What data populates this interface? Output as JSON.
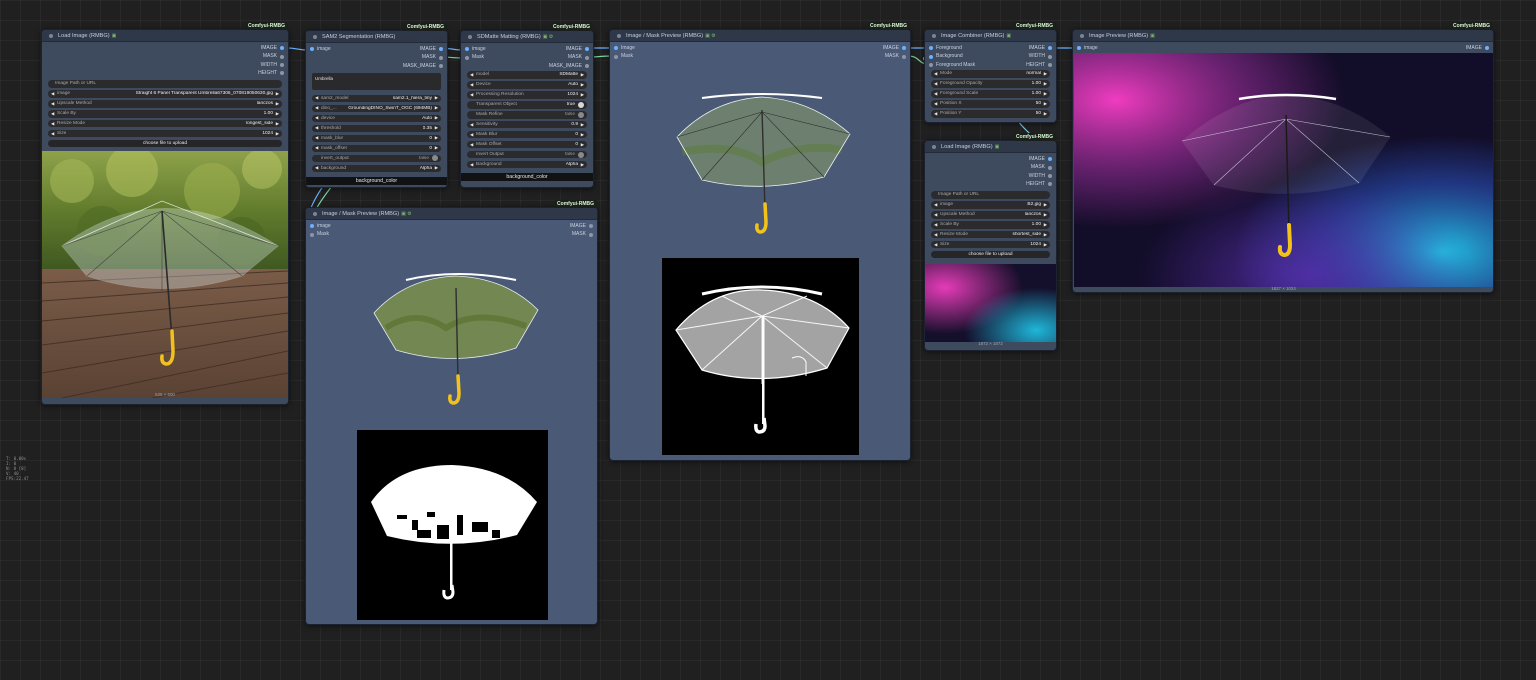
{
  "canvas_stats": [
    "T: 0.00s",
    "I: 0",
    "N: 8 [8]",
    "V: 40",
    "FPS:22.47"
  ],
  "node_load_image": {
    "badge": "Comfyui-RMBG",
    "title": "Load Image (RMBG)",
    "emoji": "🖼",
    "outputs": [
      "IMAGE",
      "MASK",
      "WIDTH",
      "HEIGHT"
    ],
    "path_placeholder": "Image Path or URL",
    "image_label": "image",
    "image_value": "Straight 6 Panel Transparent Umbrella67306_070819050630.jpg",
    "upscale_label": "Upscale Method",
    "upscale_value": "lanczos",
    "scale_label": "Scale By",
    "scale_value": "1.00",
    "resize_label": "Resize Mode",
    "resize_value": "longest_side",
    "size_label": "Size",
    "size_value": "1024",
    "upload_button": "choose file to upload",
    "caption": "625 × 600"
  },
  "node_sam2": {
    "badge": "Comfyui-RMBG",
    "title": "SAM2 Segmentation (RMBG)",
    "inputs": [
      "image"
    ],
    "outputs": [
      "IMAGE",
      "MASK",
      "MASK_IMAGE"
    ],
    "prompt_text": "Umbrella",
    "widgets": [
      {
        "label": "sam2_model",
        "value": "sam2.1_hiera_tiny"
      },
      {
        "label": "dino_...",
        "value": "GroundingDINO_SwinT_OGC (694MB)"
      },
      {
        "label": "device",
        "value": "Auto"
      },
      {
        "label": "threshold",
        "value": "0.35"
      },
      {
        "label": "mask_blur",
        "value": "0"
      },
      {
        "label": "mask_offset",
        "value": "0"
      },
      {
        "label": "invert_output",
        "value": "false"
      },
      {
        "label": "background",
        "value": "Alpha"
      }
    ],
    "bg_color_label": "background_color"
  },
  "node_sdmatte": {
    "badge": "Comfyui-RMBG",
    "title": "SDMatte Matting (RMBG)",
    "inputs": [
      "image",
      "Mask"
    ],
    "outputs": [
      "IMAGE",
      "MASK",
      "MASK_IMAGE"
    ],
    "widgets": [
      {
        "label": "model",
        "value": "SDMatte",
        "kind": "select"
      },
      {
        "label": "Device",
        "value": "Auto",
        "kind": "select"
      },
      {
        "label": "Processing Resolution",
        "value": "1024",
        "kind": "select"
      },
      {
        "label": "Transparent Object",
        "value": "true",
        "kind": "toggle-on"
      },
      {
        "label": "Mask Refine",
        "value": "false",
        "kind": "toggle"
      },
      {
        "label": "Sensitivity",
        "value": "0.9",
        "kind": "number"
      },
      {
        "label": "Mask Blur",
        "value": "0",
        "kind": "number"
      },
      {
        "label": "Mask Offset",
        "value": "0",
        "kind": "number"
      },
      {
        "label": "Invert Output",
        "value": "false",
        "kind": "toggle"
      },
      {
        "label": "Background",
        "value": "Alpha",
        "kind": "select"
      }
    ],
    "bg_color_label": "background_color"
  },
  "node_preview_sam2": {
    "badge": "Comfyui-RMBG",
    "title": "Image / Mask Preview (RMBG)",
    "inputs": [
      "image",
      "Mask"
    ],
    "outputs": [
      "IMAGE",
      "MASK"
    ]
  },
  "node_preview_sdmatte": {
    "badge": "Comfyui-RMBG",
    "title": "Image / Mask Preview (RMBG)",
    "inputs": [
      "Image",
      "Mask"
    ],
    "outputs": [
      "IMAGE",
      "MASK"
    ]
  },
  "node_combiner": {
    "badge": "Comfyui-RMBG",
    "title": "Image Combiner (RMBG)",
    "inputs": [
      "Foreground",
      "Background",
      "Foreground Mask"
    ],
    "outputs": [
      "IMAGE",
      "WIDTH",
      "HEIGHT"
    ],
    "widgets": [
      {
        "label": "Mode",
        "value": "normal"
      },
      {
        "label": "Foreground Opacity",
        "value": "1.00"
      },
      {
        "label": "Foreground Scale",
        "value": "1.00"
      },
      {
        "label": "Position X",
        "value": "50"
      },
      {
        "label": "Position Y",
        "value": "50"
      }
    ]
  },
  "node_load_image_bg": {
    "badge": "Comfyui-RMBG",
    "title": "Load Image (RMBG)",
    "outputs": [
      "IMAGE",
      "MASK",
      "WIDTH",
      "HEIGHT"
    ],
    "path_placeholder": "Image Path or URL",
    "widgets": [
      {
        "label": "image",
        "value": "B2.jpg"
      },
      {
        "label": "Upscale Method",
        "value": "lanczos"
      },
      {
        "label": "Scale By",
        "value": "1.00"
      },
      {
        "label": "Resize Mode",
        "value": "shortest_side"
      },
      {
        "label": "Size",
        "value": "1024"
      }
    ],
    "upload_button": "choose file to upload",
    "caption": "1872 × 1872"
  },
  "node_image_preview": {
    "badge": "Comfyui-RMBG",
    "title": "Image Preview (RMBG)",
    "inputs": [
      "image"
    ],
    "outputs": [
      "IMAGE"
    ],
    "caption": "1827 × 1024"
  },
  "colors": {
    "node_body": "#3e4a5e",
    "preview_body": "#4a5a76",
    "link_blue": "#6cb0ff",
    "link_green": "#7ad6a4",
    "badge_text": "#d6f5d0",
    "umbrella_handle": "#f2c21b"
  }
}
